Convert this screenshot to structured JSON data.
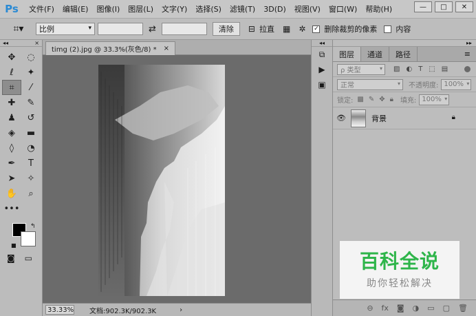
{
  "app": {
    "logo": "Ps",
    "menu": [
      "文件(F)",
      "编辑(E)",
      "图像(I)",
      "图层(L)",
      "文字(Y)",
      "选择(S)",
      "滤镜(T)",
      "3D(D)",
      "视图(V)",
      "窗口(W)",
      "帮助(H)"
    ],
    "window_buttons": [
      "—",
      "□",
      "✕"
    ]
  },
  "options": {
    "ratio_select": "比例",
    "clear_button": "清除",
    "straighten_label": "拉直",
    "delete_cropped_label": "删除裁剪的像素",
    "content_aware_label": "内容"
  },
  "document": {
    "tab_title": "timg (2).jpg @ 33.3%(灰色/8) *",
    "tab_close": "×",
    "zoom": "33.33%",
    "doc_info": "文档:902.3K/902.3K",
    "status_arrow": "›"
  },
  "layers_panel": {
    "tabs": [
      "图层",
      "通道",
      "路径"
    ],
    "filter_kind": "ρ 类型",
    "blend_mode": "正常",
    "opacity_label": "不透明度:",
    "opacity_value": "100%",
    "lock_label": "锁定:",
    "fill_label": "填充:",
    "fill_value": "100%",
    "layer_name": "背景"
  },
  "watermark": {
    "title": "百科全说",
    "subtitle": "助你轻松解决"
  },
  "colors": {
    "ps_blue": "#2a8ad4",
    "watermark_green": "#2eb54a",
    "foreground": "#000000",
    "background": "#ffffff"
  }
}
